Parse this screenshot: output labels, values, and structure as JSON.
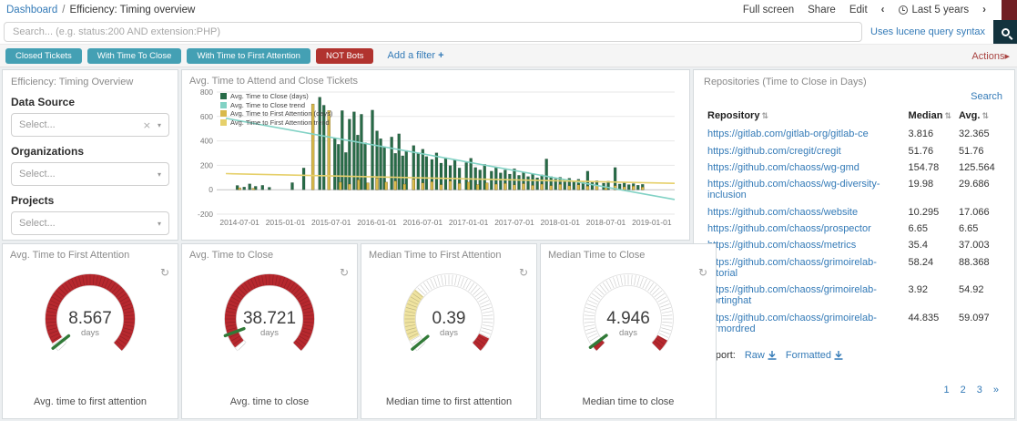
{
  "topbar": {
    "breadcrumb_root": "Dashboard",
    "breadcrumb_sep": "/",
    "breadcrumb_current": "Efficiency: Timing overview",
    "actions": [
      "Full screen",
      "Share",
      "Edit"
    ],
    "time_prev": "‹",
    "time_label": "Last 5 years",
    "time_next": "›"
  },
  "search": {
    "placeholder": "Search... (e.g. status:200 AND extension:PHP)",
    "syntax_hint": "Uses lucene query syntax"
  },
  "filters": {
    "pills": [
      {
        "label": "Closed Tickets",
        "color": "#44a0b4"
      },
      {
        "label": "With Time To Close",
        "color": "#44a0b4"
      },
      {
        "label": "With Time to First Attention",
        "color": "#44a0b4"
      },
      {
        "label": "NOT Bots",
        "color": "#b1332f"
      }
    ],
    "add_filter": "Add a filter",
    "add_filter_plus": "+",
    "actions": "Actions",
    "actions_caret": "▸"
  },
  "icons": {
    "refresh": "↻",
    "sort": "⇅",
    "clear": "×",
    "chevron_down": "▾"
  },
  "filter_panel": {
    "title": "Efficiency: Timing Overview",
    "fields": [
      {
        "key": "data-source",
        "label": "Data Source",
        "placeholder": "Select...",
        "clearable": true
      },
      {
        "key": "organizations",
        "label": "Organizations",
        "placeholder": "Select...",
        "clearable": false
      },
      {
        "key": "projects",
        "label": "Projects",
        "placeholder": "Select...",
        "clearable": false
      }
    ]
  },
  "chart_panel": {
    "title": "Avg. Time to Attend and Close Tickets"
  },
  "chart_data": {
    "type": "bar",
    "title": "Avg. Time to Attend and Close Tickets",
    "ylim": [
      -200,
      800
    ],
    "yticks": [
      -200,
      0,
      200,
      400,
      600,
      800
    ],
    "xticks": [
      "2014-07-01",
      "2015-01-01",
      "2015-07-01",
      "2016-01-01",
      "2016-07-01",
      "2017-01-01",
      "2017-07-01",
      "2018-01-01",
      "2018-07-01",
      "2019-01-01"
    ],
    "xtick_fracs": [
      0.05,
      0.15,
      0.25,
      0.35,
      0.45,
      0.55,
      0.65,
      0.75,
      0.85,
      0.95
    ],
    "legend": [
      {
        "label": "Avg. Time to Close (days)",
        "color": "#276b47"
      },
      {
        "label": "Avg. Time to Close trend",
        "color": "#82d2c5"
      },
      {
        "label": "Avg. Time to First Attention (days)",
        "color": "#d8b94b"
      },
      {
        "label": "Avg. Time to First Attention trend",
        "color": "#e6d06b"
      }
    ],
    "series": [
      {
        "name": "Avg. Time to Close (days)",
        "color": "#276b47",
        "stroke": "rgba(0,0,0,0.35)",
        "bars": [
          [
            0.045,
            35
          ],
          [
            0.06,
            22
          ],
          [
            0.072,
            48
          ],
          [
            0.085,
            28
          ],
          [
            0.1,
            36
          ],
          [
            0.115,
            20
          ],
          [
            0.165,
            58
          ],
          [
            0.19,
            178
          ],
          [
            0.225,
            758
          ],
          [
            0.234,
            692
          ],
          [
            0.258,
            425
          ],
          [
            0.266,
            372
          ],
          [
            0.274,
            648
          ],
          [
            0.282,
            305
          ],
          [
            0.29,
            578
          ],
          [
            0.3,
            638
          ],
          [
            0.308,
            448
          ],
          [
            0.316,
            618
          ],
          [
            0.324,
            385
          ],
          [
            0.34,
            652
          ],
          [
            0.35,
            482
          ],
          [
            0.358,
            418
          ],
          [
            0.366,
            352
          ],
          [
            0.382,
            432
          ],
          [
            0.39,
            298
          ],
          [
            0.398,
            458
          ],
          [
            0.406,
            278
          ],
          [
            0.414,
            322
          ],
          [
            0.43,
            362
          ],
          [
            0.44,
            302
          ],
          [
            0.45,
            332
          ],
          [
            0.458,
            272
          ],
          [
            0.47,
            248
          ],
          [
            0.48,
            302
          ],
          [
            0.49,
            218
          ],
          [
            0.5,
            262
          ],
          [
            0.51,
            198
          ],
          [
            0.52,
            242
          ],
          [
            0.53,
            178
          ],
          [
            0.545,
            222
          ],
          [
            0.555,
            258
          ],
          [
            0.565,
            182
          ],
          [
            0.575,
            162
          ],
          [
            0.585,
            208
          ],
          [
            0.6,
            152
          ],
          [
            0.61,
            182
          ],
          [
            0.62,
            138
          ],
          [
            0.63,
            162
          ],
          [
            0.64,
            128
          ],
          [
            0.65,
            172
          ],
          [
            0.66,
            118
          ],
          [
            0.67,
            142
          ],
          [
            0.68,
            108
          ],
          [
            0.69,
            132
          ],
          [
            0.7,
            98
          ],
          [
            0.71,
            122
          ],
          [
            0.72,
            252
          ],
          [
            0.73,
            108
          ],
          [
            0.74,
            88
          ],
          [
            0.75,
            102
          ],
          [
            0.76,
            80
          ],
          [
            0.77,
            94
          ],
          [
            0.78,
            72
          ],
          [
            0.79,
            86
          ],
          [
            0.8,
            64
          ],
          [
            0.81,
            152
          ],
          [
            0.82,
            60
          ],
          [
            0.83,
            74
          ],
          [
            0.845,
            54
          ],
          [
            0.855,
            70
          ],
          [
            0.87,
            182
          ],
          [
            0.88,
            47
          ],
          [
            0.89,
            57
          ],
          [
            0.9,
            42
          ],
          [
            0.91,
            50
          ],
          [
            0.92,
            37
          ],
          [
            0.93,
            44
          ]
        ]
      },
      {
        "name": "Avg. Time to First Attention (days)",
        "color": "#d8b94b",
        "stroke": "rgba(80,62,0,0.7)",
        "bars": [
          [
            0.05,
            16
          ],
          [
            0.08,
            12
          ],
          [
            0.21,
            702
          ],
          [
            0.245,
            648
          ],
          [
            0.27,
            62
          ],
          [
            0.29,
            46
          ],
          [
            0.31,
            82
          ],
          [
            0.33,
            56
          ],
          [
            0.35,
            96
          ],
          [
            0.37,
            62
          ],
          [
            0.39,
            72
          ],
          [
            0.41,
            46
          ],
          [
            0.43,
            86
          ],
          [
            0.45,
            56
          ],
          [
            0.47,
            66
          ],
          [
            0.49,
            42
          ],
          [
            0.51,
            72
          ],
          [
            0.53,
            52
          ],
          [
            0.55,
            62
          ],
          [
            0.57,
            42
          ],
          [
            0.59,
            56
          ],
          [
            0.61,
            46
          ],
          [
            0.63,
            52
          ],
          [
            0.65,
            40
          ],
          [
            0.67,
            50
          ],
          [
            0.69,
            36
          ],
          [
            0.71,
            46
          ],
          [
            0.73,
            34
          ],
          [
            0.75,
            44
          ],
          [
            0.77,
            32
          ],
          [
            0.79,
            40
          ],
          [
            0.81,
            30
          ],
          [
            0.83,
            36
          ],
          [
            0.85,
            26
          ],
          [
            0.87,
            34
          ],
          [
            0.89,
            24
          ],
          [
            0.91,
            30
          ],
          [
            0.93,
            22
          ]
        ]
      }
    ],
    "trends": [
      {
        "name": "Avg. Time to Close trend",
        "color": "#82d2c5",
        "from": [
          0.02,
          585
        ],
        "to": [
          1.0,
          -80
        ]
      },
      {
        "name": "Avg. Time to First Attention trend",
        "color": "#e6d06b",
        "from": [
          0.02,
          132
        ],
        "to": [
          1.0,
          52
        ]
      }
    ]
  },
  "repos_panel": {
    "title": "Repositories (Time to Close in Days)",
    "search_label": "Search",
    "columns": [
      "Repository",
      "Median",
      "Avg."
    ],
    "rows": [
      {
        "repo": "https://gitlab.com/gitlab-org/gitlab-ce",
        "median": "3.816",
        "avg": "32.365"
      },
      {
        "repo": "https://github.com/cregit/cregit",
        "median": "51.76",
        "avg": "51.76"
      },
      {
        "repo": "https://github.com/chaoss/wg-gmd",
        "median": "154.78",
        "avg": "125.564"
      },
      {
        "repo": "https://github.com/chaoss/wg-diversity-inclusion",
        "median": "19.98",
        "avg": "29.686"
      },
      {
        "repo": "https://github.com/chaoss/website",
        "median": "10.295",
        "avg": "17.066"
      },
      {
        "repo": "https://github.com/chaoss/prospector",
        "median": "6.65",
        "avg": "6.65"
      },
      {
        "repo": "https://github.com/chaoss/metrics",
        "median": "35.4",
        "avg": "37.003"
      },
      {
        "repo": "https://github.com/chaoss/grimoirelab-tutorial",
        "median": "58.24",
        "avg": "88.368"
      },
      {
        "repo": "https://github.com/chaoss/grimoirelab-sortinghat",
        "median": "3.92",
        "avg": "54.92"
      },
      {
        "repo": "https://github.com/chaoss/grimoirelab-sirmordred",
        "median": "44.835",
        "avg": "59.097"
      }
    ],
    "export_label": "Export:",
    "export_links": [
      "Raw",
      "Formatted"
    ],
    "pagination": [
      "1",
      "2",
      "3",
      "»"
    ]
  },
  "gauges": [
    {
      "title": "Avg. Time to First Attention",
      "value": "8.567",
      "unit": "days",
      "caption": "Avg. time to first attention",
      "needle_frac": 0.025,
      "segments": [
        [
          0,
          0.045,
          "#ffffff"
        ],
        [
          0.045,
          1,
          "#b7282e"
        ]
      ]
    },
    {
      "title": "Avg. Time to Close",
      "value": "38.721",
      "unit": "days",
      "caption": "Avg. time to close",
      "needle_frac": 0.09,
      "segments": [
        [
          0,
          0.02,
          "#ffffff"
        ],
        [
          0.02,
          1,
          "#b7282e"
        ]
      ]
    },
    {
      "title": "Median Time to First Attention",
      "value": "0.39",
      "unit": "days",
      "caption": "Median time to first attention",
      "needle_frac": 0.02,
      "segments": [
        [
          0,
          0.06,
          "#ffffff"
        ],
        [
          0.06,
          0.32,
          "#efe3a0"
        ],
        [
          0.32,
          0.93,
          "#ffffff"
        ],
        [
          0.93,
          1,
          "#b7282e"
        ]
      ]
    },
    {
      "title": "Median Time to Close",
      "value": "4.946",
      "unit": "days",
      "caption": "Median time to close",
      "needle_frac": 0.03,
      "segments": [
        [
          0,
          0.03,
          "#b7282e"
        ],
        [
          0.03,
          0.94,
          "#ffffff"
        ],
        [
          0.94,
          1,
          "#b7282e"
        ]
      ]
    }
  ]
}
